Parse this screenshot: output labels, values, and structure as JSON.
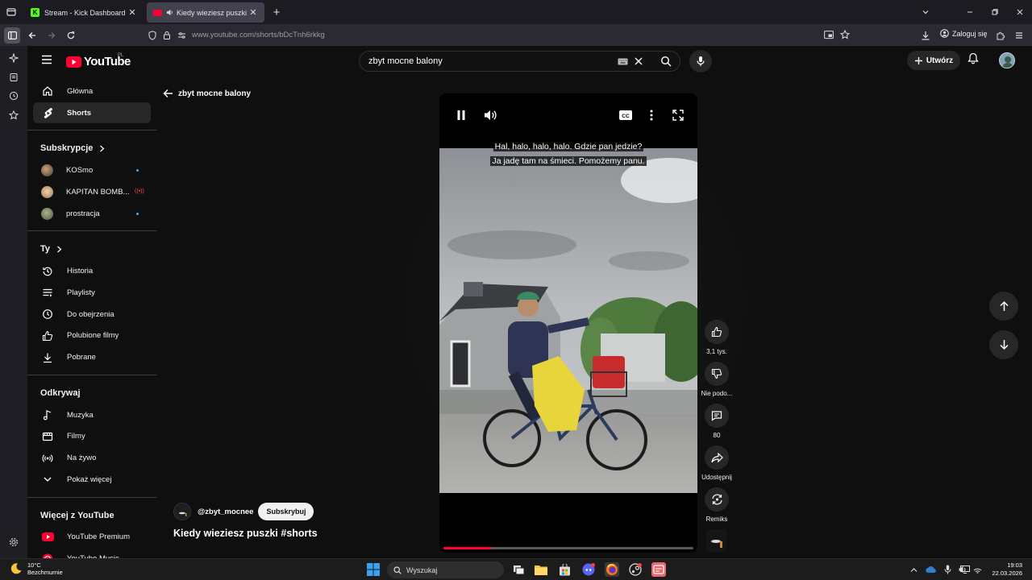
{
  "browser": {
    "tabs": [
      {
        "title": "Stream - Kick Dashboard",
        "close": "✕"
      },
      {
        "title": "Kiedy wieziesz puszki #shorts",
        "close": "✕"
      }
    ],
    "new_tab": "+",
    "url": "www.youtube.com/shorts/bDcTnh6rkkg",
    "login_label": "Zaloguj się"
  },
  "youtube": {
    "logo_word": "YouTube",
    "region": "PL",
    "search_query": "zbyt mocne balony",
    "create_label": "Utwórz",
    "sidebar": {
      "main": [
        {
          "label": "Główna",
          "icon": "home-icon"
        },
        {
          "label": "Shorts",
          "icon": "shorts-icon"
        }
      ],
      "subs_header": "Subskrypcje",
      "subs": [
        {
          "label": "KOSmo",
          "color": "#6b5a4a"
        },
        {
          "label": "KAPITAN BOMB...",
          "color": "#d9b48a",
          "badge": "((•))"
        },
        {
          "label": "prostracja",
          "color": "#7a8a6a"
        }
      ],
      "you_header": "Ty",
      "you": [
        {
          "label": "Historia",
          "icon": "history-icon"
        },
        {
          "label": "Playlisty",
          "icon": "playlist-icon"
        },
        {
          "label": "Do obejrzenia",
          "icon": "watch-later-icon"
        },
        {
          "label": "Polubione filmy",
          "icon": "like-icon"
        },
        {
          "label": "Pobrane",
          "icon": "download-icon"
        }
      ],
      "explore_header": "Odkrywaj",
      "explore": [
        {
          "label": "Muzyka",
          "icon": "music-icon"
        },
        {
          "label": "Filmy",
          "icon": "film-icon"
        },
        {
          "label": "Na żywo",
          "icon": "live-icon"
        },
        {
          "label": "Pokaż więcej",
          "icon": "chevron-down-icon"
        }
      ],
      "more_header": "Więcej z YouTube",
      "more": [
        {
          "label": "YouTube Premium"
        },
        {
          "label": "YouTube Music"
        }
      ]
    },
    "back_label": "zbyt mocne balony",
    "caption_lines": [
      "Hal, halo, halo, halo. Gdzie pan jedzie?",
      "Ja jadę tam na śmieci. Pomożemy panu."
    ],
    "progress_fraction": 0.19,
    "actions": [
      {
        "label": "3,1 tys.",
        "icon": "thumbs-up-icon"
      },
      {
        "label": "Nie podo...",
        "icon": "thumbs-down-icon"
      },
      {
        "label": "80",
        "icon": "comment-icon"
      },
      {
        "label": "Udostępnij",
        "icon": "share-icon"
      },
      {
        "label": "Remiks",
        "icon": "remix-icon"
      }
    ],
    "channel": "@zbyt_mocnee",
    "subscribe_label": "Subskrybuj",
    "video_title": "Kiedy wieziesz puszki #shorts"
  },
  "taskbar": {
    "weather_temp": "10°C",
    "weather_desc": "Bezchmurnie",
    "search_placeholder": "Wyszukaj",
    "time": "19:03",
    "date": "22.03.2026"
  }
}
